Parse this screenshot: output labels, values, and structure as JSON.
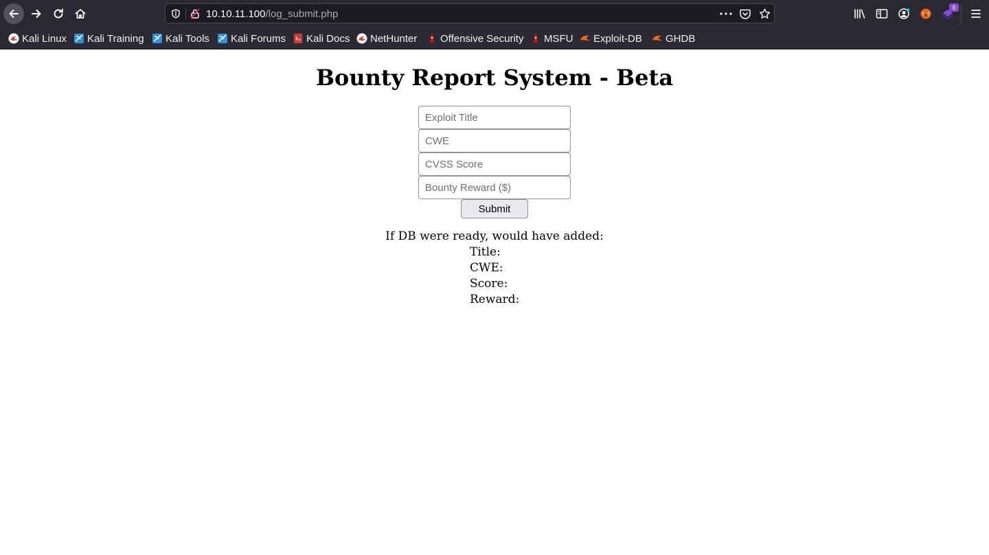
{
  "browser": {
    "url_host": "10.10.11.100",
    "url_path": "/log_submit.php",
    "extension_badge": "6",
    "bookmarks": [
      {
        "label": "Kali Linux",
        "icon": "kali-dragon-icon"
      },
      {
        "label": "Kali Training",
        "icon": "kali-training-icon"
      },
      {
        "label": "Kali Tools",
        "icon": "kali-tools-icon"
      },
      {
        "label": "Kali Forums",
        "icon": "kali-forums-icon"
      },
      {
        "label": "Kali Docs",
        "icon": "kali-docs-icon"
      },
      {
        "label": "NetHunter",
        "icon": "kali-dragon-icon"
      },
      {
        "label": "Offensive Security",
        "icon": "offsec-icon"
      },
      {
        "label": "MSFU",
        "icon": "offsec-icon"
      },
      {
        "label": "Exploit-DB",
        "icon": "exploit-db-icon"
      },
      {
        "label": "GHDB",
        "icon": "exploit-db-icon"
      }
    ]
  },
  "page": {
    "heading": "Bounty Report System - Beta",
    "form": {
      "title_placeholder": "Exploit Title",
      "cwe_placeholder": "CWE",
      "score_placeholder": "CVSS Score",
      "reward_placeholder": "Bounty Reward ($)",
      "submit_label": "Submit"
    },
    "result": {
      "heading": "If DB were ready, would have added:",
      "title_label": "Title:",
      "cwe_label": "CWE:",
      "score_label": "Score:",
      "reward_label": "Reward:"
    }
  },
  "colors": {
    "chrome_bg": "#2b2a33",
    "urlbar_bg": "#1c1b22",
    "kali_red": "#d13b3b",
    "kali_blue": "#2f8fe0",
    "exploitdb_orange": "#e86a1f",
    "extension_purple": "#8a4bd6"
  }
}
